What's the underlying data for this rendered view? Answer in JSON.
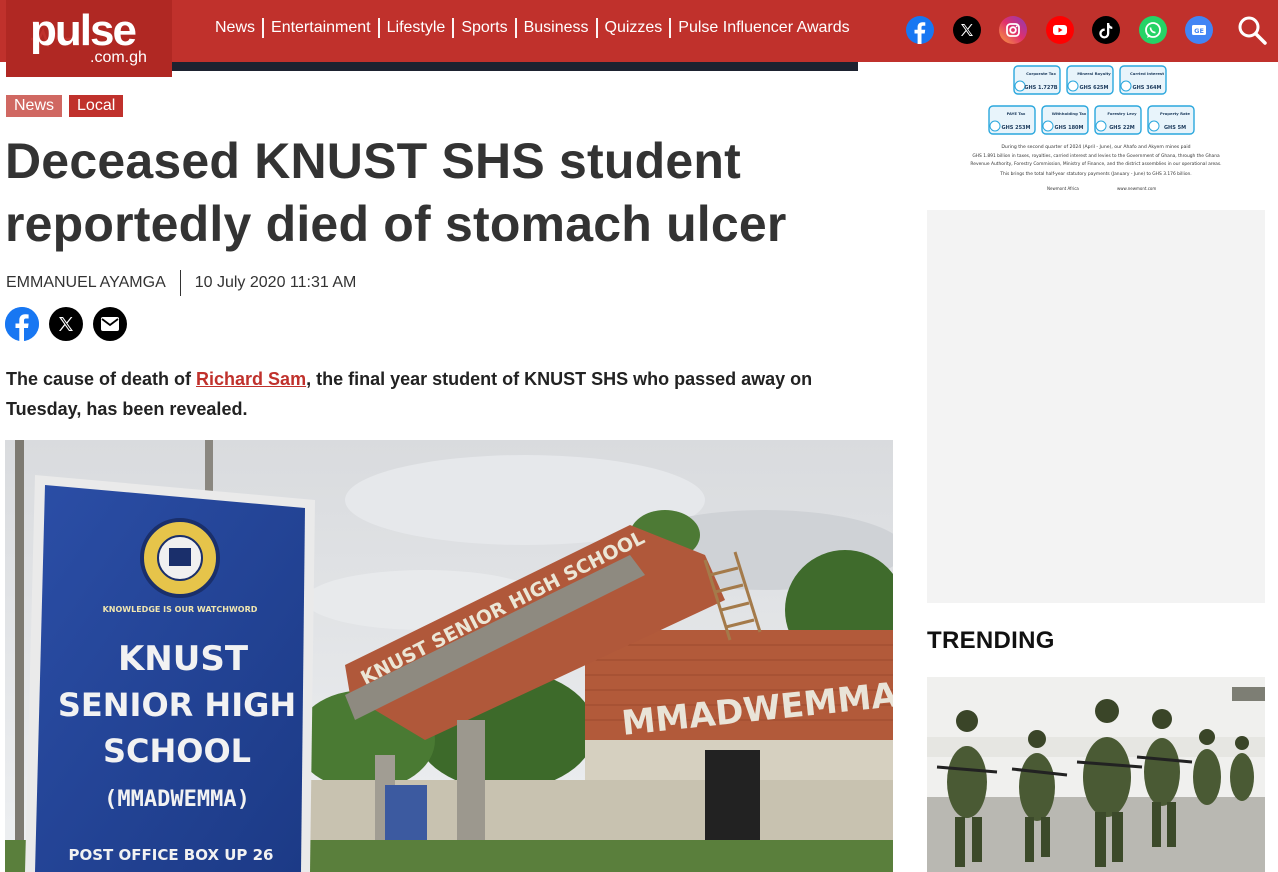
{
  "site": {
    "logo_word": "pulse",
    "logo_sub": ".com.gh",
    "brand_color": "#c0312c"
  },
  "nav": {
    "items": [
      "News",
      "Entertainment",
      "Lifestyle",
      "Sports",
      "Business",
      "Quizzes",
      "Pulse Influencer Awards"
    ]
  },
  "socials": [
    {
      "name": "facebook-icon",
      "color": "#1877f2"
    },
    {
      "name": "x-icon",
      "color": "#000000"
    },
    {
      "name": "instagram-icon",
      "color": "#e1306c"
    },
    {
      "name": "youtube-icon",
      "color": "#ff0000"
    },
    {
      "name": "tiktok-icon",
      "color": "#000000"
    },
    {
      "name": "whatsapp-icon",
      "color": "#25d366"
    },
    {
      "name": "google-news-icon",
      "color": "#4285f4"
    }
  ],
  "article": {
    "tags": [
      "News",
      "Local"
    ],
    "title": "Deceased KNUST SHS student reportedly died of stomach ulcer",
    "author": "EMMANUEL AYAMGA",
    "date": "10 July 2020 11:31 AM",
    "lead_prefix": "The cause of death of ",
    "lead_link": "Richard Sam",
    "lead_suffix": ", the final year student of KNUST SHS who passed away on Tuesday, has been revealed.",
    "photo": {
      "sign_lines": [
        "KNUST",
        "SENIOR HIGH",
        "SCHOOL",
        "(MMADWEMMA)",
        "POST OFFICE BOX UP 26"
      ],
      "motto": "KNOWLEDGE IS OUR WATCHWORD",
      "gate_arch": "KNUST SENIOR HIGH SCHOOL",
      "gate_wall": "MMADWEMMA"
    }
  },
  "sidebar": {
    "infographic": {
      "row1": [
        {
          "label": "Corporate Tax",
          "value": "GHS 1.727B"
        },
        {
          "label": "Mineral Royalty",
          "value": "GHS 625M"
        },
        {
          "label": "Carried Interest",
          "value": "GHS 364M"
        }
      ],
      "row2": [
        {
          "label": "PAYE Tax",
          "value": "GHS 253M"
        },
        {
          "label": "Withholding Tax",
          "value": "GHS 180M"
        },
        {
          "label": "Forestry Levy",
          "value": "GHS 22M"
        },
        {
          "label": "Property Rate",
          "value": "GHS 5M"
        }
      ],
      "caption1": "During the second quarter of 2024 (April - June), our Ahafo and Akyem mines paid",
      "caption2": "GHS 1.891 billion in taxes, royalties, carried interest and levies to the Government of Ghana, through the Ghana",
      "caption3": "Revenue Authority, Forestry Commission, Ministry of Finance, and the district assemblies in our operational areas.",
      "caption4": "This brings the total half-year statutory payments (January - June) to GHS 3.176 billion.",
      "footer_left": "Newmont Africa",
      "footer_right": "www.newmont.com"
    },
    "trending_label": "TRENDING"
  }
}
